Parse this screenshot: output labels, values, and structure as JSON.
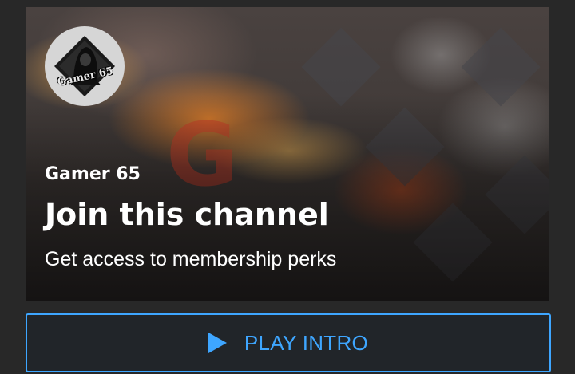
{
  "banner": {
    "channel_name": "Gamer 65",
    "title": "Join this channel",
    "subtitle": "Get access to membership perks",
    "avatar_text": "Gamer 65",
    "avatar_icon": "hooded-figure-icon"
  },
  "actions": {
    "play_intro_label": "PLAY INTRO",
    "play_icon": "play-icon"
  },
  "colors": {
    "accent": "#3ea6ff",
    "background": "#282828",
    "button_bg": "#212529"
  }
}
